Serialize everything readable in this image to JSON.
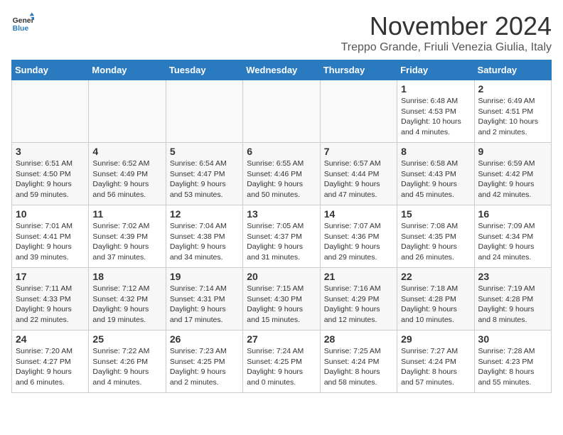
{
  "logo": {
    "text1": "General",
    "text2": "Blue"
  },
  "title": "November 2024",
  "location": "Treppo Grande, Friuli Venezia Giulia, Italy",
  "days_of_week": [
    "Sunday",
    "Monday",
    "Tuesday",
    "Wednesday",
    "Thursday",
    "Friday",
    "Saturday"
  ],
  "weeks": [
    [
      {
        "day": "",
        "info": ""
      },
      {
        "day": "",
        "info": ""
      },
      {
        "day": "",
        "info": ""
      },
      {
        "day": "",
        "info": ""
      },
      {
        "day": "",
        "info": ""
      },
      {
        "day": "1",
        "info": "Sunrise: 6:48 AM\nSunset: 4:53 PM\nDaylight: 10 hours and 4 minutes."
      },
      {
        "day": "2",
        "info": "Sunrise: 6:49 AM\nSunset: 4:51 PM\nDaylight: 10 hours and 2 minutes."
      }
    ],
    [
      {
        "day": "3",
        "info": "Sunrise: 6:51 AM\nSunset: 4:50 PM\nDaylight: 9 hours and 59 minutes."
      },
      {
        "day": "4",
        "info": "Sunrise: 6:52 AM\nSunset: 4:49 PM\nDaylight: 9 hours and 56 minutes."
      },
      {
        "day": "5",
        "info": "Sunrise: 6:54 AM\nSunset: 4:47 PM\nDaylight: 9 hours and 53 minutes."
      },
      {
        "day": "6",
        "info": "Sunrise: 6:55 AM\nSunset: 4:46 PM\nDaylight: 9 hours and 50 minutes."
      },
      {
        "day": "7",
        "info": "Sunrise: 6:57 AM\nSunset: 4:44 PM\nDaylight: 9 hours and 47 minutes."
      },
      {
        "day": "8",
        "info": "Sunrise: 6:58 AM\nSunset: 4:43 PM\nDaylight: 9 hours and 45 minutes."
      },
      {
        "day": "9",
        "info": "Sunrise: 6:59 AM\nSunset: 4:42 PM\nDaylight: 9 hours and 42 minutes."
      }
    ],
    [
      {
        "day": "10",
        "info": "Sunrise: 7:01 AM\nSunset: 4:41 PM\nDaylight: 9 hours and 39 minutes."
      },
      {
        "day": "11",
        "info": "Sunrise: 7:02 AM\nSunset: 4:39 PM\nDaylight: 9 hours and 37 minutes."
      },
      {
        "day": "12",
        "info": "Sunrise: 7:04 AM\nSunset: 4:38 PM\nDaylight: 9 hours and 34 minutes."
      },
      {
        "day": "13",
        "info": "Sunrise: 7:05 AM\nSunset: 4:37 PM\nDaylight: 9 hours and 31 minutes."
      },
      {
        "day": "14",
        "info": "Sunrise: 7:07 AM\nSunset: 4:36 PM\nDaylight: 9 hours and 29 minutes."
      },
      {
        "day": "15",
        "info": "Sunrise: 7:08 AM\nSunset: 4:35 PM\nDaylight: 9 hours and 26 minutes."
      },
      {
        "day": "16",
        "info": "Sunrise: 7:09 AM\nSunset: 4:34 PM\nDaylight: 9 hours and 24 minutes."
      }
    ],
    [
      {
        "day": "17",
        "info": "Sunrise: 7:11 AM\nSunset: 4:33 PM\nDaylight: 9 hours and 22 minutes."
      },
      {
        "day": "18",
        "info": "Sunrise: 7:12 AM\nSunset: 4:32 PM\nDaylight: 9 hours and 19 minutes."
      },
      {
        "day": "19",
        "info": "Sunrise: 7:14 AM\nSunset: 4:31 PM\nDaylight: 9 hours and 17 minutes."
      },
      {
        "day": "20",
        "info": "Sunrise: 7:15 AM\nSunset: 4:30 PM\nDaylight: 9 hours and 15 minutes."
      },
      {
        "day": "21",
        "info": "Sunrise: 7:16 AM\nSunset: 4:29 PM\nDaylight: 9 hours and 12 minutes."
      },
      {
        "day": "22",
        "info": "Sunrise: 7:18 AM\nSunset: 4:28 PM\nDaylight: 9 hours and 10 minutes."
      },
      {
        "day": "23",
        "info": "Sunrise: 7:19 AM\nSunset: 4:28 PM\nDaylight: 9 hours and 8 minutes."
      }
    ],
    [
      {
        "day": "24",
        "info": "Sunrise: 7:20 AM\nSunset: 4:27 PM\nDaylight: 9 hours and 6 minutes."
      },
      {
        "day": "25",
        "info": "Sunrise: 7:22 AM\nSunset: 4:26 PM\nDaylight: 9 hours and 4 minutes."
      },
      {
        "day": "26",
        "info": "Sunrise: 7:23 AM\nSunset: 4:25 PM\nDaylight: 9 hours and 2 minutes."
      },
      {
        "day": "27",
        "info": "Sunrise: 7:24 AM\nSunset: 4:25 PM\nDaylight: 9 hours and 0 minutes."
      },
      {
        "day": "28",
        "info": "Sunrise: 7:25 AM\nSunset: 4:24 PM\nDaylight: 8 hours and 58 minutes."
      },
      {
        "day": "29",
        "info": "Sunrise: 7:27 AM\nSunset: 4:24 PM\nDaylight: 8 hours and 57 minutes."
      },
      {
        "day": "30",
        "info": "Sunrise: 7:28 AM\nSunset: 4:23 PM\nDaylight: 8 hours and 55 minutes."
      }
    ]
  ]
}
